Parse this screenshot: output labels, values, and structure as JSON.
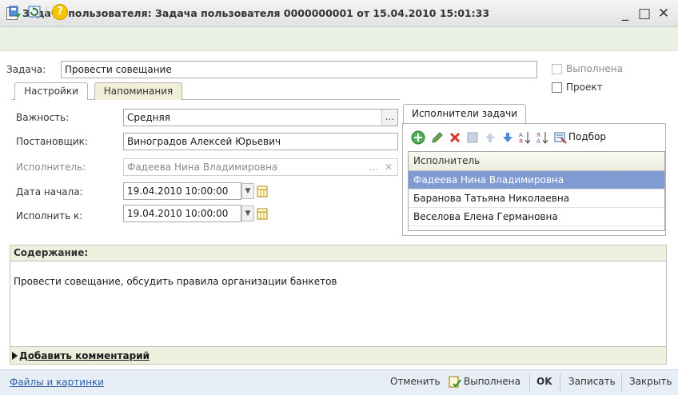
{
  "window": {
    "title": "Задача пользователя: Задача пользователя 0000000001 от 15.04.2010 15:01:33",
    "min": "_",
    "max": "□",
    "close": "✕"
  },
  "toolbar": {
    "icons": [
      "save-post-icon",
      "refresh-icon",
      "help-icon"
    ],
    "help_glyph": "?"
  },
  "task": {
    "label": "Задача:",
    "value": "Провести совещание",
    "done_label": "Выполнена",
    "project_label": "Проект"
  },
  "tabs": [
    {
      "label": "Настройки",
      "active": true
    },
    {
      "label": "Напоминания",
      "active": false
    }
  ],
  "settings": {
    "importance_label": "Важность:",
    "importance_value": "Средняя",
    "assigner_label": "Постановщик:",
    "assigner_value": "Виноградов Алексей Юрьевич",
    "executor_label": "Исполнитель:",
    "executor_value": "Фадеева Нина Владимировна",
    "start_label": "Дата начала:",
    "start_value": "19.04.2010 10:00:00",
    "due_label": "Исполнить к:",
    "due_value": "19.04.2010 10:00:00",
    "ellipsis": "...",
    "clear": "✕"
  },
  "executors": {
    "tab_label": "Исполнители задачи",
    "pick_label": "Подбор",
    "column": "Исполнитель",
    "rows": [
      {
        "name": "Фадеева Нина Владимировна",
        "selected": true
      },
      {
        "name": "Баранова Татьяна Николаевна",
        "selected": false
      },
      {
        "name": "Веселова Елена Германовна",
        "selected": false
      }
    ]
  },
  "content": {
    "header": "Содержание:",
    "text": "Провести совещание, обсудить правила организации банкетов",
    "add_comment": "Добавить комментарий"
  },
  "bottom": {
    "files_link": "Файлы и картинки",
    "cancel": "Отменить",
    "done": "Выполнена",
    "ok": "OK",
    "save": "Записать",
    "close": "Закрыть"
  },
  "colors": {
    "selection": "#7f9bd2",
    "toolbar_bg": "#eaf3e3",
    "link": "#2e5ea8"
  }
}
